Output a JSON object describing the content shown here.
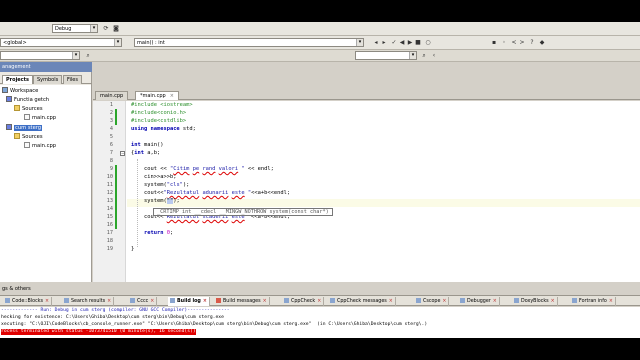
{
  "toolbar": {
    "build_target": "Debug",
    "scope": "<global>",
    "function": "main() : int",
    "search_left": "",
    "search_right": ""
  },
  "management": {
    "title": "anagement",
    "tabs": [
      "Projects",
      "Symbols",
      "Files"
    ],
    "tree": [
      {
        "label": "Workspace",
        "icon": "workspace-icon",
        "level": 0
      },
      {
        "label": "Functia getch",
        "icon": "project-icon",
        "level": 1
      },
      {
        "label": "Sources",
        "icon": "folder-icon",
        "level": 2
      },
      {
        "label": "main.cpp",
        "icon": "file-icon",
        "level": 3
      },
      {
        "label": "cum sterg",
        "icon": "project-icon",
        "level": 1,
        "selected": true
      },
      {
        "label": "Sources",
        "icon": "folder-icon",
        "level": 2
      },
      {
        "label": "main.cpp",
        "icon": "file-icon",
        "level": 3
      }
    ]
  },
  "editor": {
    "tabs": [
      {
        "label": "main.cpp",
        "active": false
      },
      {
        "label": "*main.cpp",
        "active": true
      }
    ],
    "line_numbers": [
      "1",
      "2",
      "3",
      "4",
      "5",
      "6",
      "7",
      "8",
      "9",
      "10",
      "11",
      "12",
      "13",
      "14",
      "15",
      "16",
      "17",
      "18",
      "19"
    ],
    "calltip": "_CRTIMP int __cdecl __MINGW_NOTHROW system(const char*)"
  },
  "log": {
    "title": "gs & others",
    "tabs": [
      {
        "label": "Code::Blocks",
        "active": false
      },
      {
        "label": "Search results",
        "active": false
      },
      {
        "label": "Cccc",
        "active": false
      },
      {
        "label": "Build log",
        "active": true
      },
      {
        "label": "Build messages",
        "active": false
      },
      {
        "label": "CppCheck",
        "active": false
      },
      {
        "label": "CppCheck messages",
        "active": false
      },
      {
        "label": "Cscope",
        "active": false
      },
      {
        "label": "Debugger",
        "active": false
      },
      {
        "label": "DoxyBlocks",
        "active": false
      },
      {
        "label": "Fortran info",
        "active": false
      }
    ],
    "lines": [
      "------------- Run: Debug in cum sterg (compiler: GNU GCC Compiler)---------------",
      "hecking for existence: C:\\Users\\Ghiba\\Desktop\\cum sterg\\bin\\Debug\\cum sterg.exe",
      "xecuting: \"C:\\OJI\\CodeBlocks\\cb_console_runner.exe\" \"C:\\Users\\Ghiba\\Desktop\\cum sterg\\bin\\Debug\\cum sterg.exe\"  (in C:\\Users\\Ghiba\\Desktop\\cum sterg\\.)",
      "rocess terminated with status -1073741510 (0 minute(s), 16 second(s))"
    ]
  }
}
